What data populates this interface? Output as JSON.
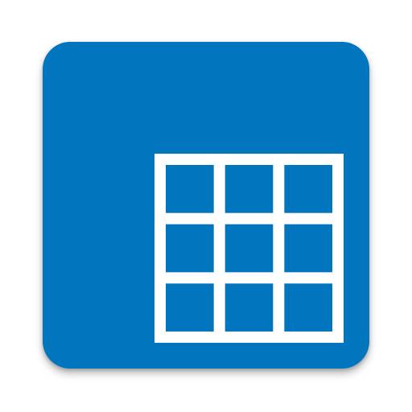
{
  "app_icon": {
    "icon": "grid-3x3-icon",
    "background_color": "#0275bf",
    "glyph_color": "#ffffff",
    "rows": 3,
    "columns": 3
  }
}
